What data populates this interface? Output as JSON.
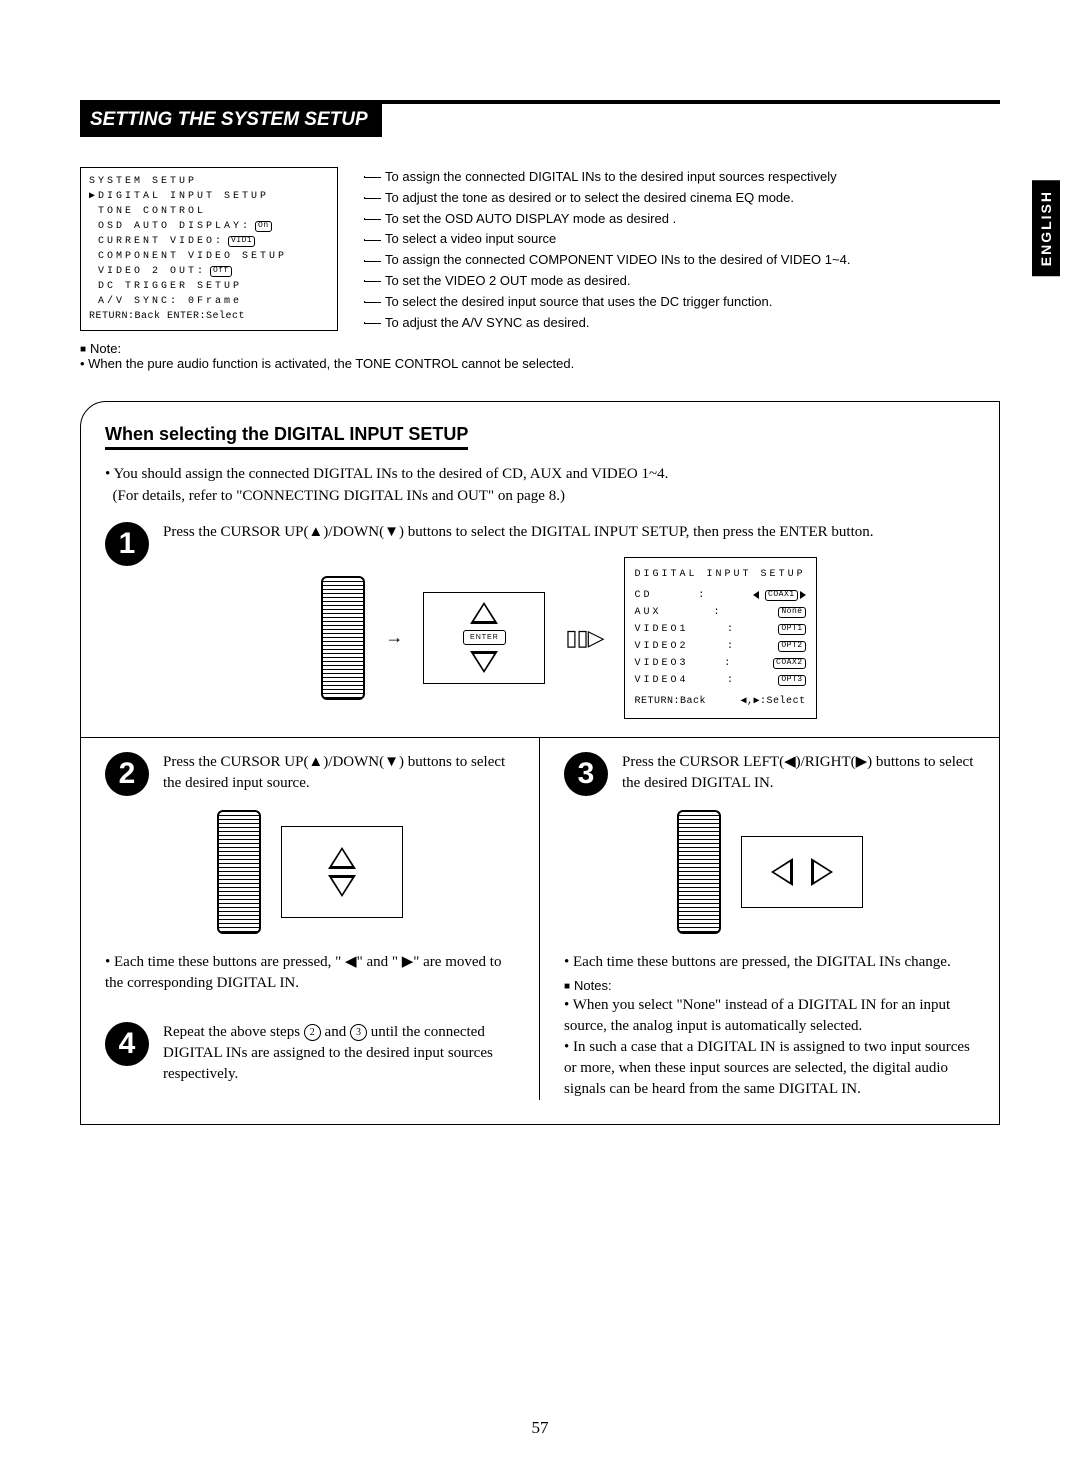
{
  "sideTab": "ENGLISH",
  "title": "SETTING THE SYSTEM SETUP",
  "osdMain": {
    "header": "SYSTEM      SETUP",
    "lines": [
      {
        "label": "DIGITAL INPUT SETUP",
        "pointer": true
      },
      {
        "label": "TONE CONTROL"
      },
      {
        "label": "OSD AUTO DISPLAY:",
        "pill": "On"
      },
      {
        "label": "CURRENT VIDEO:",
        "pill": "VID1"
      },
      {
        "label": "COMPONENT VIDEO SETUP"
      },
      {
        "label": "VIDEO 2 OUT:",
        "pill": "Off"
      },
      {
        "label": "DC TRIGGER SETUP"
      },
      {
        "label": "A/V SYNC: 0Frame"
      }
    ],
    "footer": "RETURN:Back ENTER:Select"
  },
  "descriptions": [
    "To assign the connected DIGITAL INs to the desired input sources respectively",
    "To adjust the tone as desired or to select the desired cinema EQ mode.",
    "To set the OSD AUTO DISPLAY mode as desired .",
    "To select a video input source",
    "To assign the connected COMPONENT VIDEO INs to the desired of VIDEO 1~4.",
    "To set the VIDEO 2 OUT mode as desired.",
    "To select the desired input source that uses the DC trigger function.",
    "To adjust the A/V SYNC as desired."
  ],
  "noteLabel": "Note:",
  "noteText": "• When the pure audio function is activated, the TONE CONTROL cannot be selected.",
  "subTitle": "When selecting the DIGITAL INPUT SETUP",
  "introLine1": "• You should assign the connected DIGITAL INs to the desired of CD, AUX and VIDEO 1~4.",
  "introLine2": "(For details, refer to \"CONNECTING DIGITAL INs and OUT\" on page 8.)",
  "step1": "Press the CURSOR UP(▲)/DOWN(▼) buttons to select the DIGITAL INPUT SETUP, then press the ENTER button.",
  "enterLabel": "ENTER",
  "osdDigital": {
    "title": "DIGITAL INPUT SETUP",
    "rows": [
      {
        "src": "CD",
        "val": "COAX1",
        "sel": true
      },
      {
        "src": "AUX",
        "val": "None",
        "sel": false
      },
      {
        "src": "VIDEO1",
        "val": "OPT1",
        "sel": false
      },
      {
        "src": "VIDEO2",
        "val": "OPT2",
        "sel": false
      },
      {
        "src": "VIDEO3",
        "val": "COAX2",
        "sel": false
      },
      {
        "src": "VIDEO4",
        "val": "OPT3",
        "sel": false
      }
    ],
    "footerLeft": "RETURN:Back",
    "footerRight": "◀,▶:Select"
  },
  "step2": "Press the CURSOR UP(▲)/DOWN(▼) buttons to select the desired input source.",
  "step2After": "• Each time these buttons are pressed, \" ◀\" and \" ▶\" are moved to the corresponding DIGITAL IN.",
  "step3": "Press the CURSOR LEFT(◀)/RIGHT(▶) buttons to select the desired DIGITAL IN.",
  "step3After1": "• Each time these buttons are pressed, the DIGITAL INs change.",
  "notesLabel": "Notes:",
  "step3After2": "• When you select \"None\" instead of a DIGITAL IN for an input source, the analog input is automatically selected.",
  "step3After3": "• In such a case that a DIGITAL IN is assigned to two input sources or more, when these input sources are selected, the digital audio signals can be heard from the same DIGITAL IN.",
  "step4a": "Repeat the above steps ",
  "step4b": " and ",
  "step4c": " until the connected DIGITAL INs are assigned to the desired input sources respectively.",
  "pageNum": "57"
}
